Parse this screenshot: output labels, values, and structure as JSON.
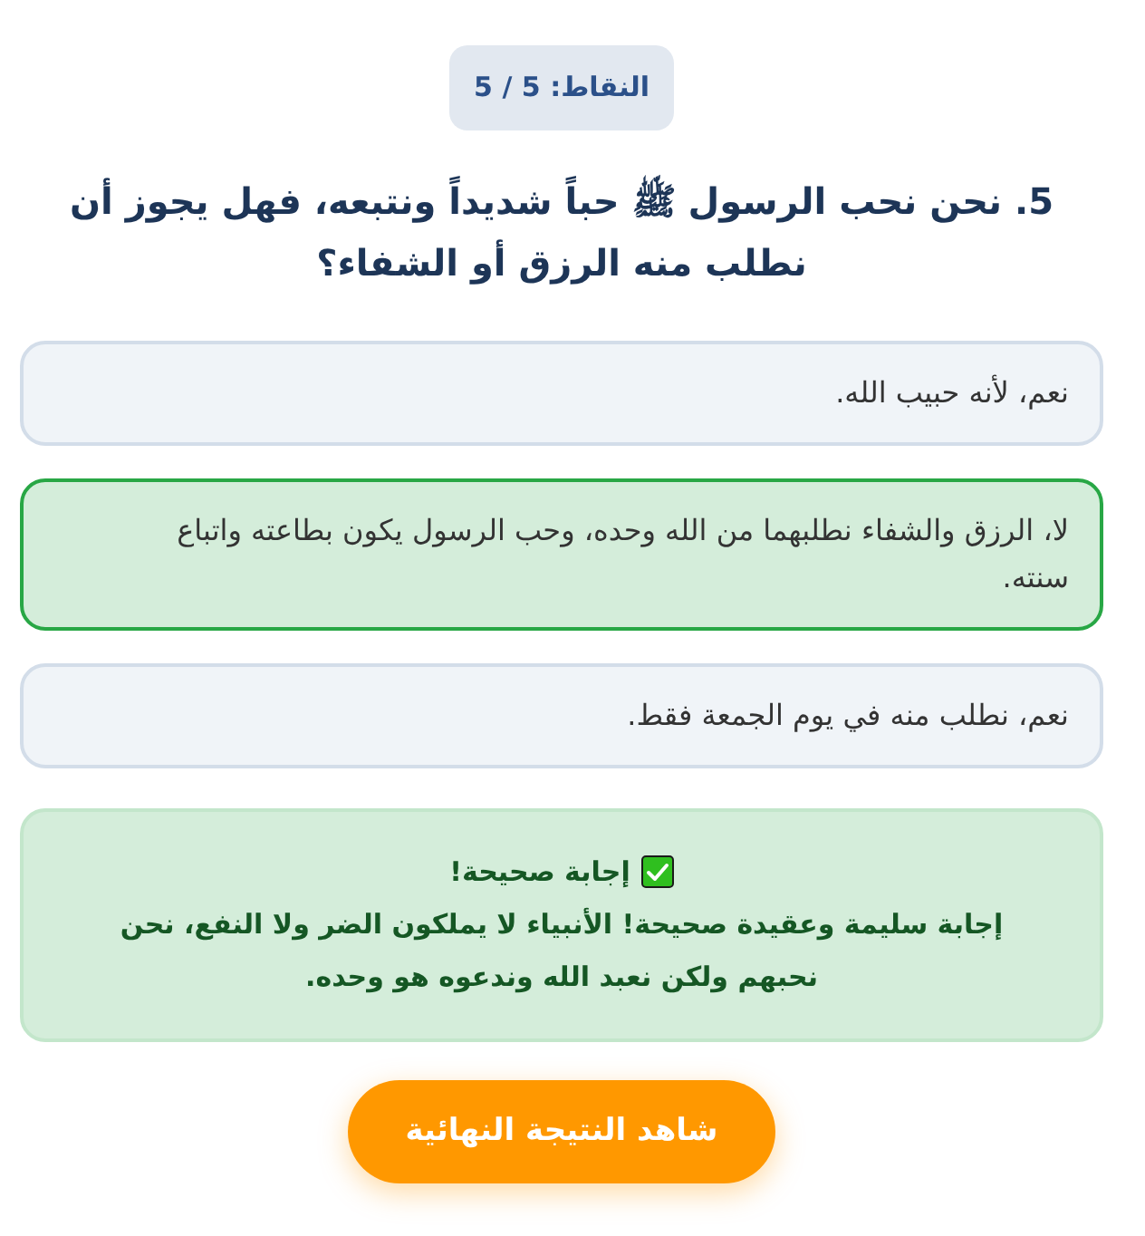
{
  "score": {
    "text": "النقاط: 5 / 5"
  },
  "question": {
    "text": "5. نحن نحب الرسول ﷺ حباً شديداً ونتبعه، فهل يجوز أن نطلب منه الرزق أو الشفاء؟"
  },
  "options": [
    {
      "text": "نعم، لأنه حبيب الله.",
      "correct": false
    },
    {
      "text": "لا، الرزق والشفاء نطلبهما من الله وحده، وحب الرسول يكون بطاعته واتباع سنته.",
      "correct": true
    },
    {
      "text": "نعم، نطلب منه في يوم الجمعة فقط.",
      "correct": false
    }
  ],
  "feedback": {
    "correct": true,
    "title": "إجابة صحيحة!",
    "text": "إجابة سليمة وعقيدة صحيحة! الأنبياء لا يملكون الضر ولا النفع، نحن نحبهم ولكن نعبد الله وندعوه هو وحده."
  },
  "button": {
    "label": "شاهد النتيجة النهائية"
  }
}
